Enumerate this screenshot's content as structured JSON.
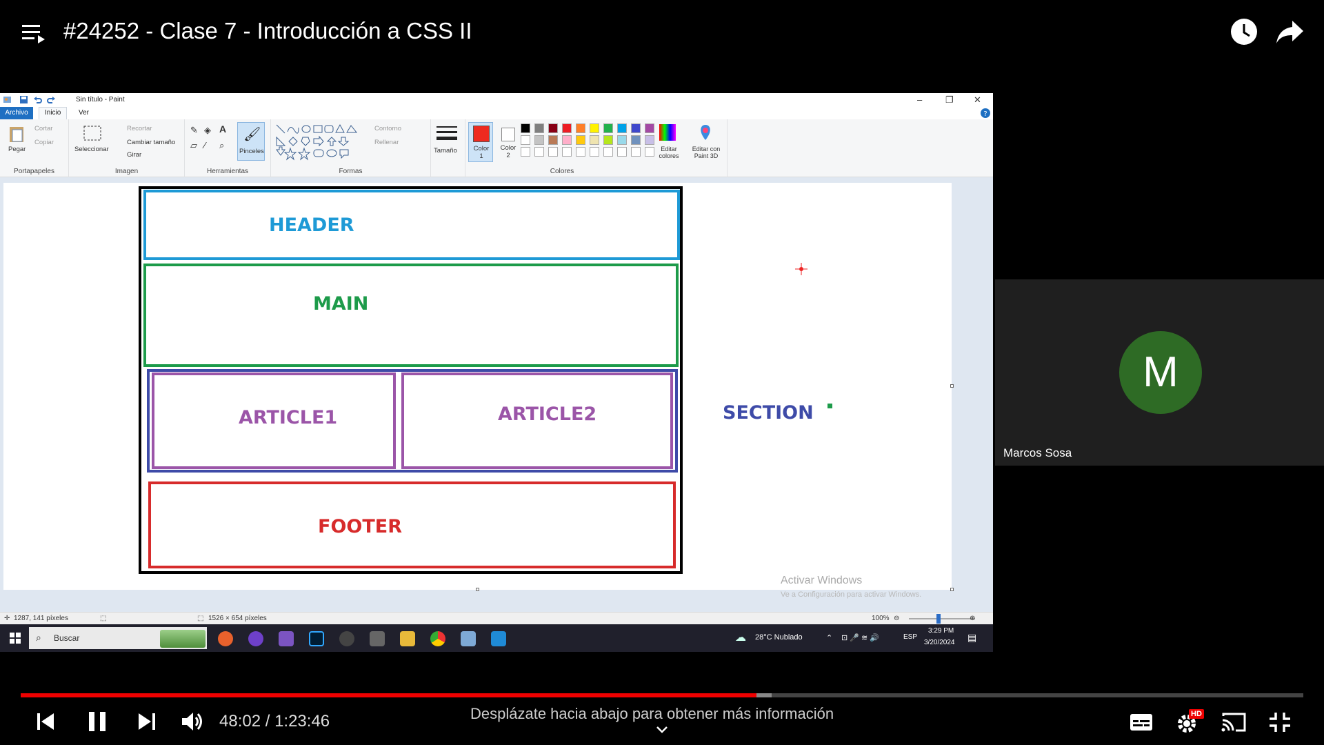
{
  "video": {
    "title": "#24252 - Clase 7 - Introducción a CSS II",
    "time_current": "48:02",
    "time_total": "1:23:46",
    "time_display": "48:02 / 1:23:46",
    "progress_fraction": 0.5734,
    "buffered_fraction": 0.5855,
    "scroll_hint": "Desplázate hacia abajo para obtener más información",
    "quality_badge": "HD",
    "progress_color": "#e00000"
  },
  "paint": {
    "window_title": "Sin título - Paint",
    "menu": [
      "Archivo",
      "Inicio",
      "Ver"
    ],
    "groups": {
      "clipboard": {
        "label": "Portapapeles",
        "paste": "Pegar",
        "cut": "Cortar",
        "copy": "Copiar"
      },
      "image": {
        "label": "Imagen",
        "select": "Seleccionar",
        "crop": "Recortar",
        "resize": "Cambiar tamaño",
        "rotate": "Girar"
      },
      "tools": {
        "label": "Herramientas",
        "brushes": "Pinceles"
      },
      "shapes": {
        "label": "Formas",
        "outline": "Contorno",
        "fill": "Rellenar"
      },
      "size": {
        "label": "Tamaño"
      },
      "colors": {
        "label": "Colores",
        "color1": "Color 1",
        "color2": "Color 2",
        "edit": "Editar colores",
        "paint3d": "Editar con Paint 3D"
      }
    },
    "status": {
      "cursor": "1287, 141 píxeles",
      "selection": "1526 × 654 píxeles",
      "zoom": "100%"
    },
    "canvas_labels": {
      "header": "HEADER",
      "main": "MAIN",
      "article1": "ARTICLE1",
      "article2": "ARTICLE2",
      "section": "SECTION",
      "footer": "FOOTER"
    },
    "activation": {
      "title": "Activar Windows",
      "subtitle": "Ve a Configuración para activar Windows."
    },
    "colors": {
      "header": "#1e9ad6",
      "main": "#1d9b4a",
      "article": "#9b55a8",
      "section": "#3e4ba8",
      "footer": "#d72b2b"
    }
  },
  "taskbar": {
    "search": "Buscar",
    "weather": "28°C  Nublado",
    "lang": "ESP",
    "time": "3:29 PM",
    "date": "3/20/2024"
  },
  "participant": {
    "initial": "M",
    "name": "Marcos Sosa",
    "avatar_color": "#2e6b25"
  }
}
